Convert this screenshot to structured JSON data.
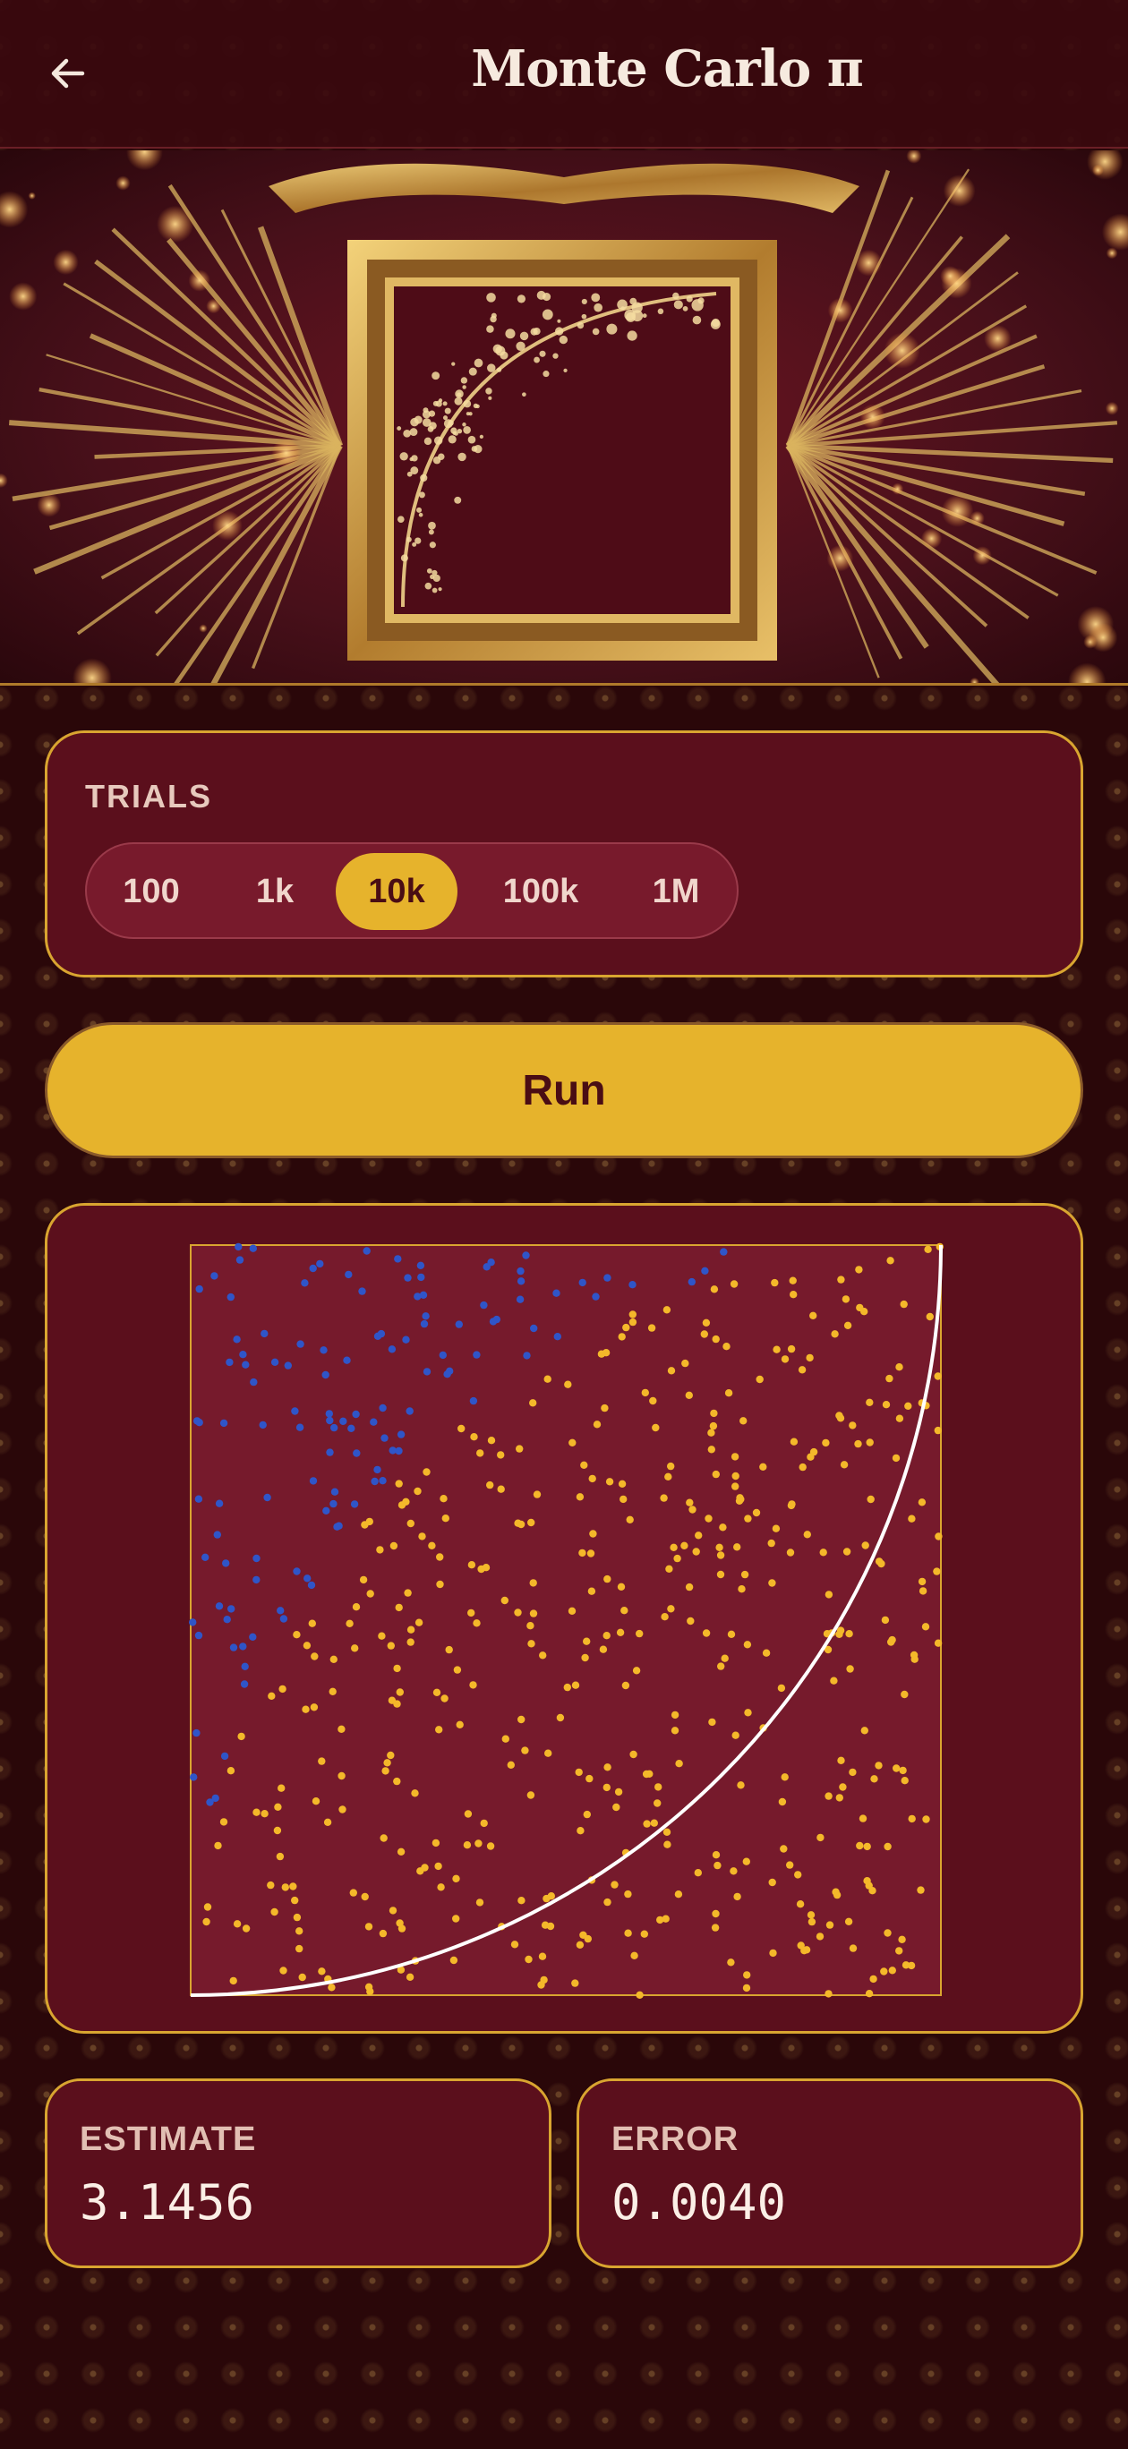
{
  "header": {
    "title": "Monte Carlo π",
    "back_icon": "arrow-left-icon"
  },
  "hero": {
    "icon": "gilded-frame-illustration"
  },
  "trials": {
    "label": "TRIALS",
    "options": [
      "100",
      "1k",
      "10k",
      "100k",
      "1M"
    ],
    "selected": "10k"
  },
  "run": {
    "label": "Run"
  },
  "plot": {
    "inside_color": "#f4b82a",
    "outside_color": "#2f55c8",
    "arc_color": "#ffffff",
    "background_color": "#761a2c"
  },
  "stats": {
    "estimate_label": "ESTIMATE",
    "estimate_value": "3.1456",
    "error_label": "ERROR",
    "error_value": "0.0040"
  },
  "colors": {
    "accent": "#e6b32c",
    "card": "#5b0f1c",
    "border": "#d9a530",
    "page": "#2a0709"
  }
}
